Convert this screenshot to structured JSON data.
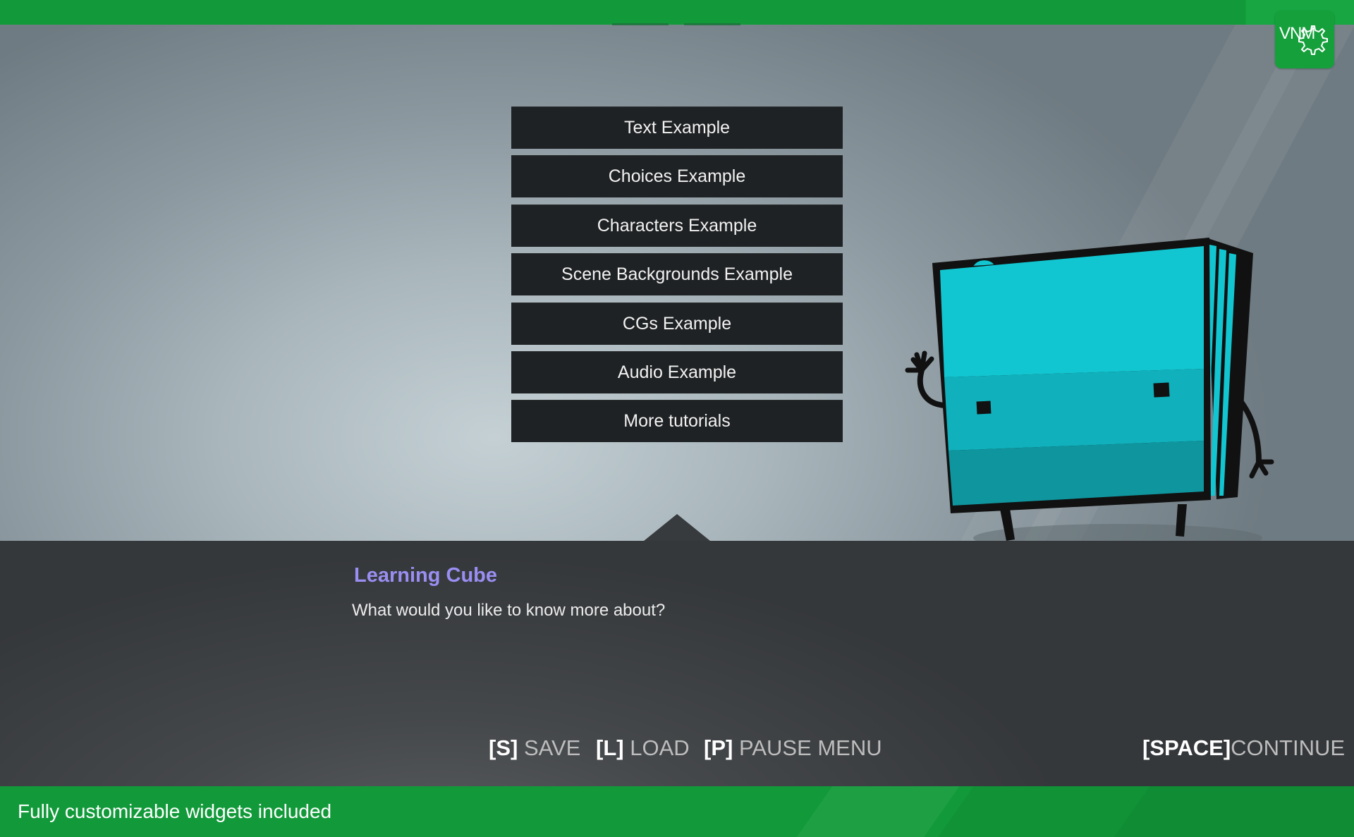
{
  "logo": {
    "text": "VNM"
  },
  "choices": [
    "Text Example",
    "Choices Example",
    "Characters Example",
    "Scene Backgrounds Example",
    "CGs Example",
    "Audio Example",
    "More tutorials"
  ],
  "dialog": {
    "speaker": "Learning Cube",
    "text": "What would you like to know more about?"
  },
  "hotkeys": {
    "save": {
      "key": "[S]",
      "label": "SAVE"
    },
    "load": {
      "key": "[L]",
      "label": "LOAD"
    },
    "pause": {
      "key": "[P]",
      "label": "PAUSE MENU"
    },
    "continue": {
      "key": "[SPACE]",
      "label": "CONTINUE"
    }
  },
  "footer": {
    "caption": "Fully customizable widgets included"
  },
  "colors": {
    "brand_green": "#129a3a",
    "button_bg": "#1f2224",
    "speaker_name": "#9b8ef2",
    "cube_face": "#12c6d1"
  },
  "icons": [
    "gear-icon",
    "dialog-pointer-arrow"
  ]
}
